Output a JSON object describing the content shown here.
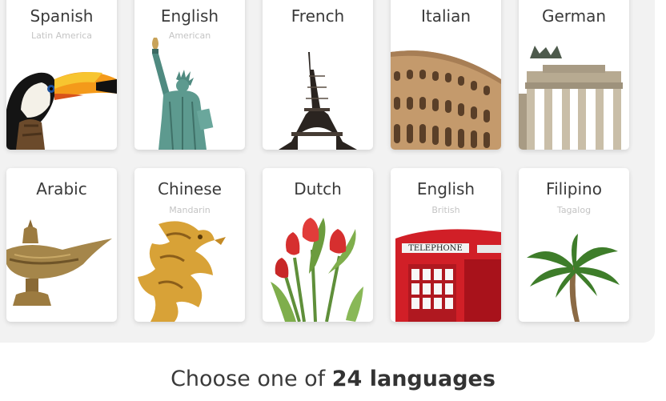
{
  "languages": [
    {
      "name": "Spanish",
      "variant": "Latin America",
      "icon": "toucan-icon"
    },
    {
      "name": "English",
      "variant": "American",
      "icon": "statue-of-liberty-icon"
    },
    {
      "name": "French",
      "variant": "",
      "icon": "eiffel-tower-icon"
    },
    {
      "name": "Italian",
      "variant": "",
      "icon": "colosseum-icon"
    },
    {
      "name": "German",
      "variant": "",
      "icon": "brandenburg-gate-icon"
    },
    {
      "name": "Arabic",
      "variant": "",
      "icon": "oil-lamp-icon"
    },
    {
      "name": "Chinese",
      "variant": "Mandarin",
      "icon": "dragon-icon"
    },
    {
      "name": "Dutch",
      "variant": "",
      "icon": "tulips-icon"
    },
    {
      "name": "English",
      "variant": "British",
      "icon": "telephone-box-icon"
    },
    {
      "name": "Filipino",
      "variant": "Tagalog",
      "icon": "palm-tree-icon"
    }
  ],
  "telephone_sign": "TELEPHONE",
  "footer": {
    "prefix": "Choose one of ",
    "count": "24 languages"
  }
}
